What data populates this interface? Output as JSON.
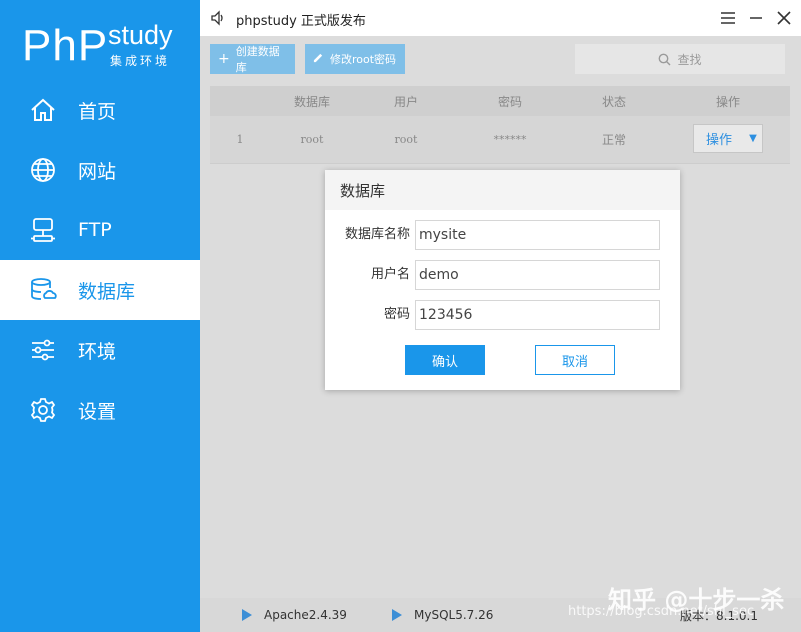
{
  "sidebar": {
    "logo_main": "PhP",
    "logo_study": "study",
    "logo_sub": "集成环境",
    "items": [
      {
        "label": "首页",
        "icon": "home-icon"
      },
      {
        "label": "网站",
        "icon": "globe-icon"
      },
      {
        "label": "FTP",
        "icon": "ftp-server-icon"
      },
      {
        "label": "数据库",
        "icon": "database-icon",
        "active": true
      },
      {
        "label": "环境",
        "icon": "sliders-icon"
      },
      {
        "label": "设置",
        "icon": "gear-icon"
      }
    ]
  },
  "titlebar": {
    "title": "phpstudy 正式版发布",
    "icons": [
      "speaker-icon",
      "menu-icon",
      "minimize-icon",
      "close-icon"
    ]
  },
  "toolbar": {
    "create_db": "创建数据库",
    "modify_root_pw": "修改root密码",
    "search_placeholder": "查找"
  },
  "table": {
    "columns": [
      "数据库",
      "用户",
      "密码",
      "状态",
      "操作"
    ],
    "rows": [
      {
        "index": "1",
        "database": "root",
        "user": "root",
        "password": "******",
        "status": "正常",
        "action": "操作"
      }
    ]
  },
  "modal": {
    "title": "数据库",
    "fields": [
      {
        "label": "数据库名称",
        "value": "mysite"
      },
      {
        "label": "用户名",
        "value": "demo"
      },
      {
        "label": "密码",
        "value": "123456"
      }
    ],
    "confirm": "确认",
    "cancel": "取消"
  },
  "statusbar": {
    "services": [
      "Apache2.4.39",
      "MySQL5.7.26"
    ],
    "version": "版本：8.1.0.1"
  },
  "watermark": {
    "zhihu": "知乎 @十步一杀",
    "csdn": "https://blog.csdn.net/shi_sec"
  },
  "colors": {
    "brand": "#1a96ea",
    "toolbar_button": "#7fbfe8"
  }
}
